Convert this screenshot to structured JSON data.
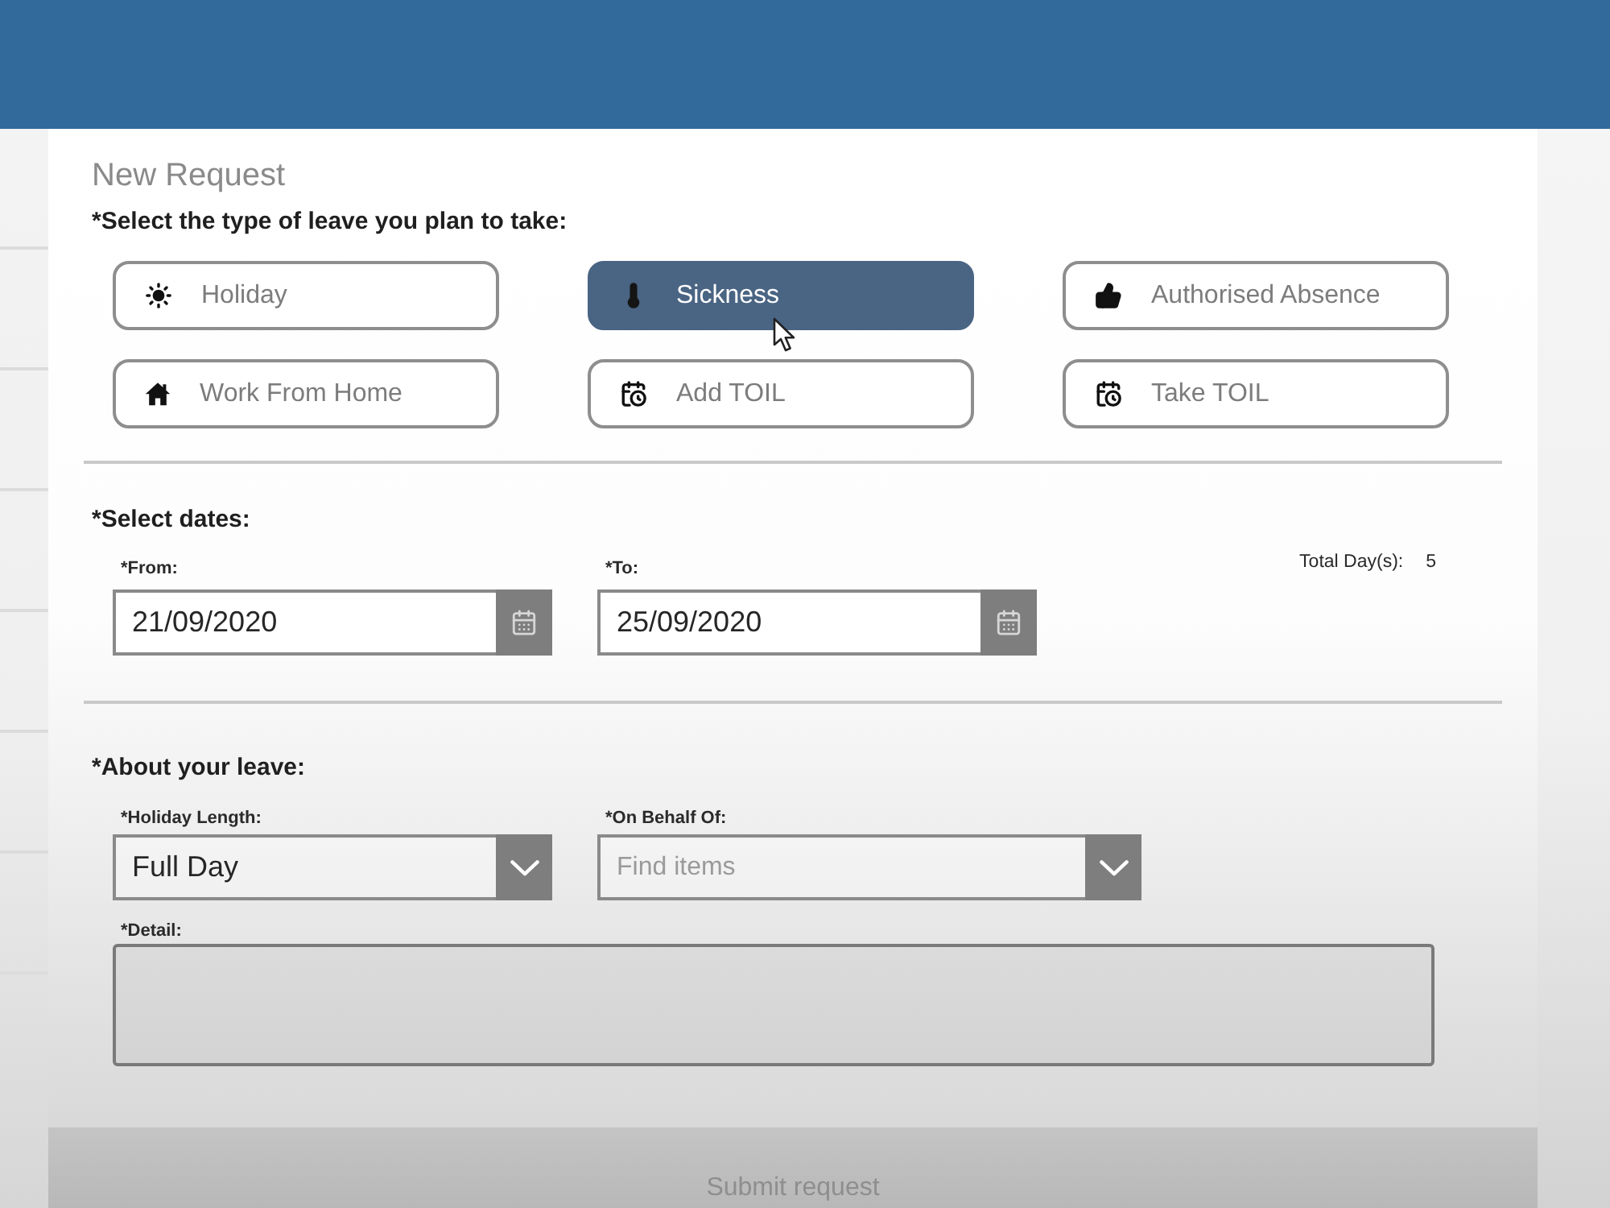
{
  "form": {
    "title": "New Request",
    "leave_type": {
      "label": "*Select the type of leave you plan to take:",
      "options": [
        {
          "label": "Holiday",
          "selected": false
        },
        {
          "label": "Sickness",
          "selected": true
        },
        {
          "label": "Authorised Absence",
          "selected": false
        },
        {
          "label": "Work From Home",
          "selected": false
        },
        {
          "label": "Add TOIL",
          "selected": false
        },
        {
          "label": "Take TOIL",
          "selected": false
        }
      ]
    },
    "dates": {
      "label": "*Select dates:",
      "from": {
        "label": "*From:",
        "value": "21/09/2020"
      },
      "to": {
        "label": "*To:",
        "value": "25/09/2020"
      },
      "total": {
        "label": "Total Day(s):",
        "value": "5"
      }
    },
    "about": {
      "label": "*About your leave:",
      "holiday_length": {
        "label": "*Holiday Length:",
        "value": "Full Day"
      },
      "on_behalf_of": {
        "label": "*On Behalf Of:",
        "placeholder": "Find items"
      },
      "detail": {
        "label": "*Detail:"
      }
    },
    "submit": {
      "label": "Submit request",
      "disabled": true
    }
  }
}
